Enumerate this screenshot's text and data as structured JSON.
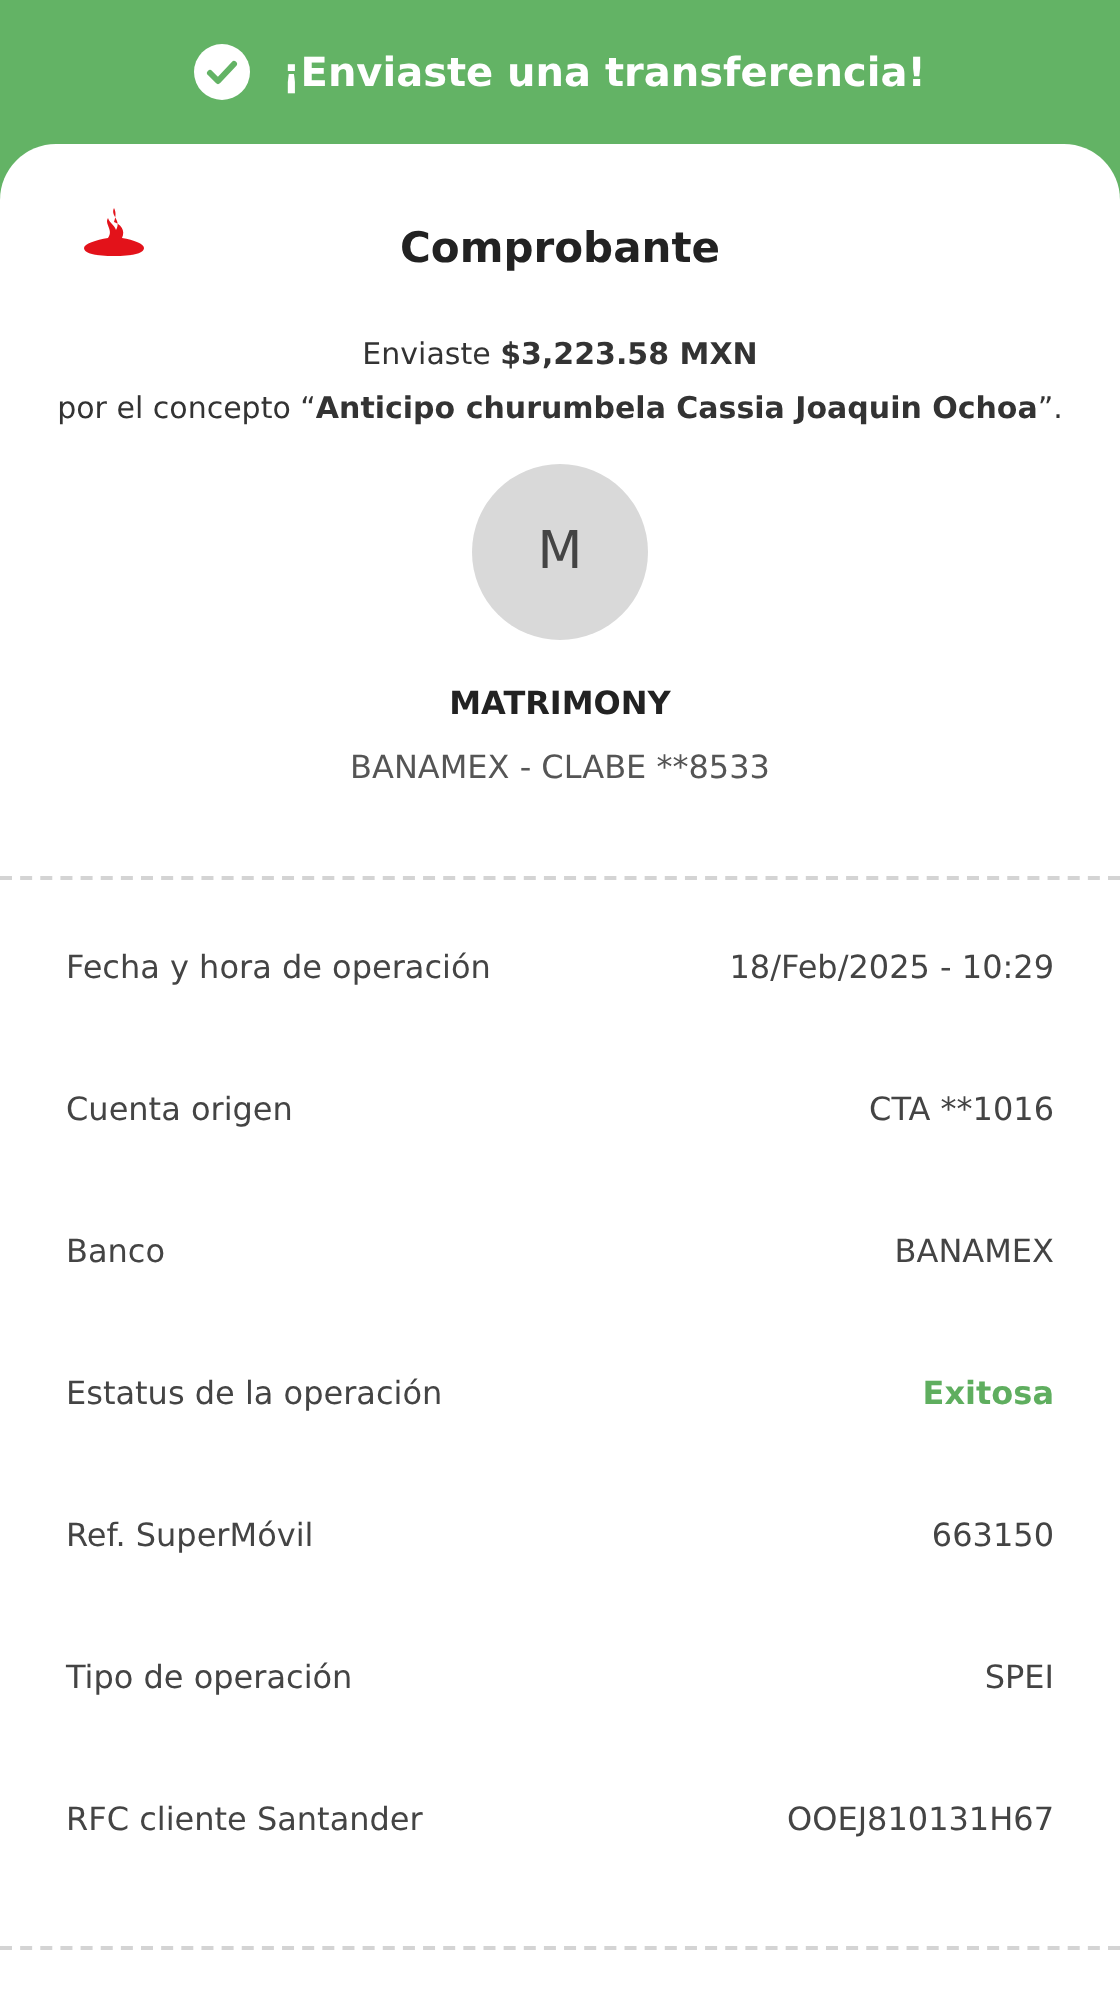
{
  "banner": {
    "title": "¡Enviaste una transferencia!"
  },
  "receipt": {
    "title": "Comprobante",
    "summary_lines": [
      "Enviaste **$3,223.58 MXN**",
      "por el concepto “**Anticipo churumbela Cassia Joaquin Ochoa**”."
    ]
  },
  "recipient": {
    "initial": "M",
    "name": "MATRIMONY",
    "account": "BANAMEX - CLABE **8533"
  },
  "details": [
    {
      "label": "Fecha y hora de operación",
      "value": "18/Feb/2025 - 10:29",
      "kind": "plain"
    },
    {
      "label": "Cuenta origen",
      "value": "CTA **1016",
      "kind": "plain"
    },
    {
      "label": "Banco",
      "value": "BANAMEX",
      "kind": "plain"
    },
    {
      "label": "Estatus de la operación",
      "value": "Exitosa",
      "kind": "success"
    },
    {
      "label": "Ref. SuperMóvil",
      "value": "663150",
      "kind": "plain"
    },
    {
      "label": "Tipo de operación",
      "value": "SPEI",
      "kind": "plain"
    },
    {
      "label": "RFC cliente Santander",
      "value": "OOEJ810131H67",
      "kind": "plain"
    }
  ]
}
